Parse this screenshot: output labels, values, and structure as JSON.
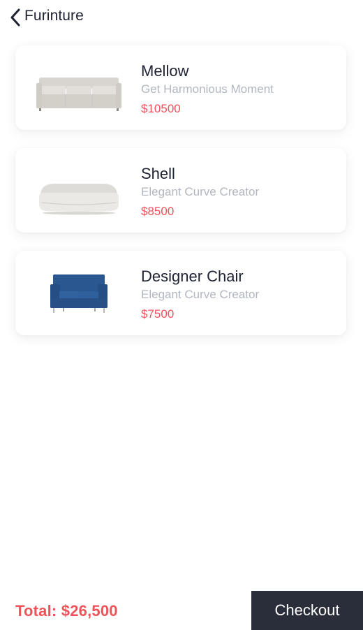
{
  "header": {
    "title": "Furinture",
    "back_icon": "chevron-left-icon"
  },
  "products": [
    {
      "name": "Mellow",
      "subtitle": "Get Harmonious Moment",
      "price": "$10500",
      "image": "sofa-mellow-image"
    },
    {
      "name": "Shell",
      "subtitle": "Elegant Curve Creator",
      "price": "$8500",
      "image": "sofa-shell-image"
    },
    {
      "name": "Designer Chair",
      "subtitle": "Elegant Curve Creator",
      "price": "$7500",
      "image": "loveseat-blue-image"
    }
  ],
  "footer": {
    "total_label": "Total:",
    "total_value": "$26,500",
    "checkout_label": "Checkout"
  },
  "colors": {
    "text_dark": "#1e2233",
    "text_muted": "#b1b6c0",
    "price_red": "#f0525a",
    "checkout_bg": "#2a2d3a",
    "sofa_grey": "#d9d6d1",
    "chair_blue": "#2c5b93"
  }
}
